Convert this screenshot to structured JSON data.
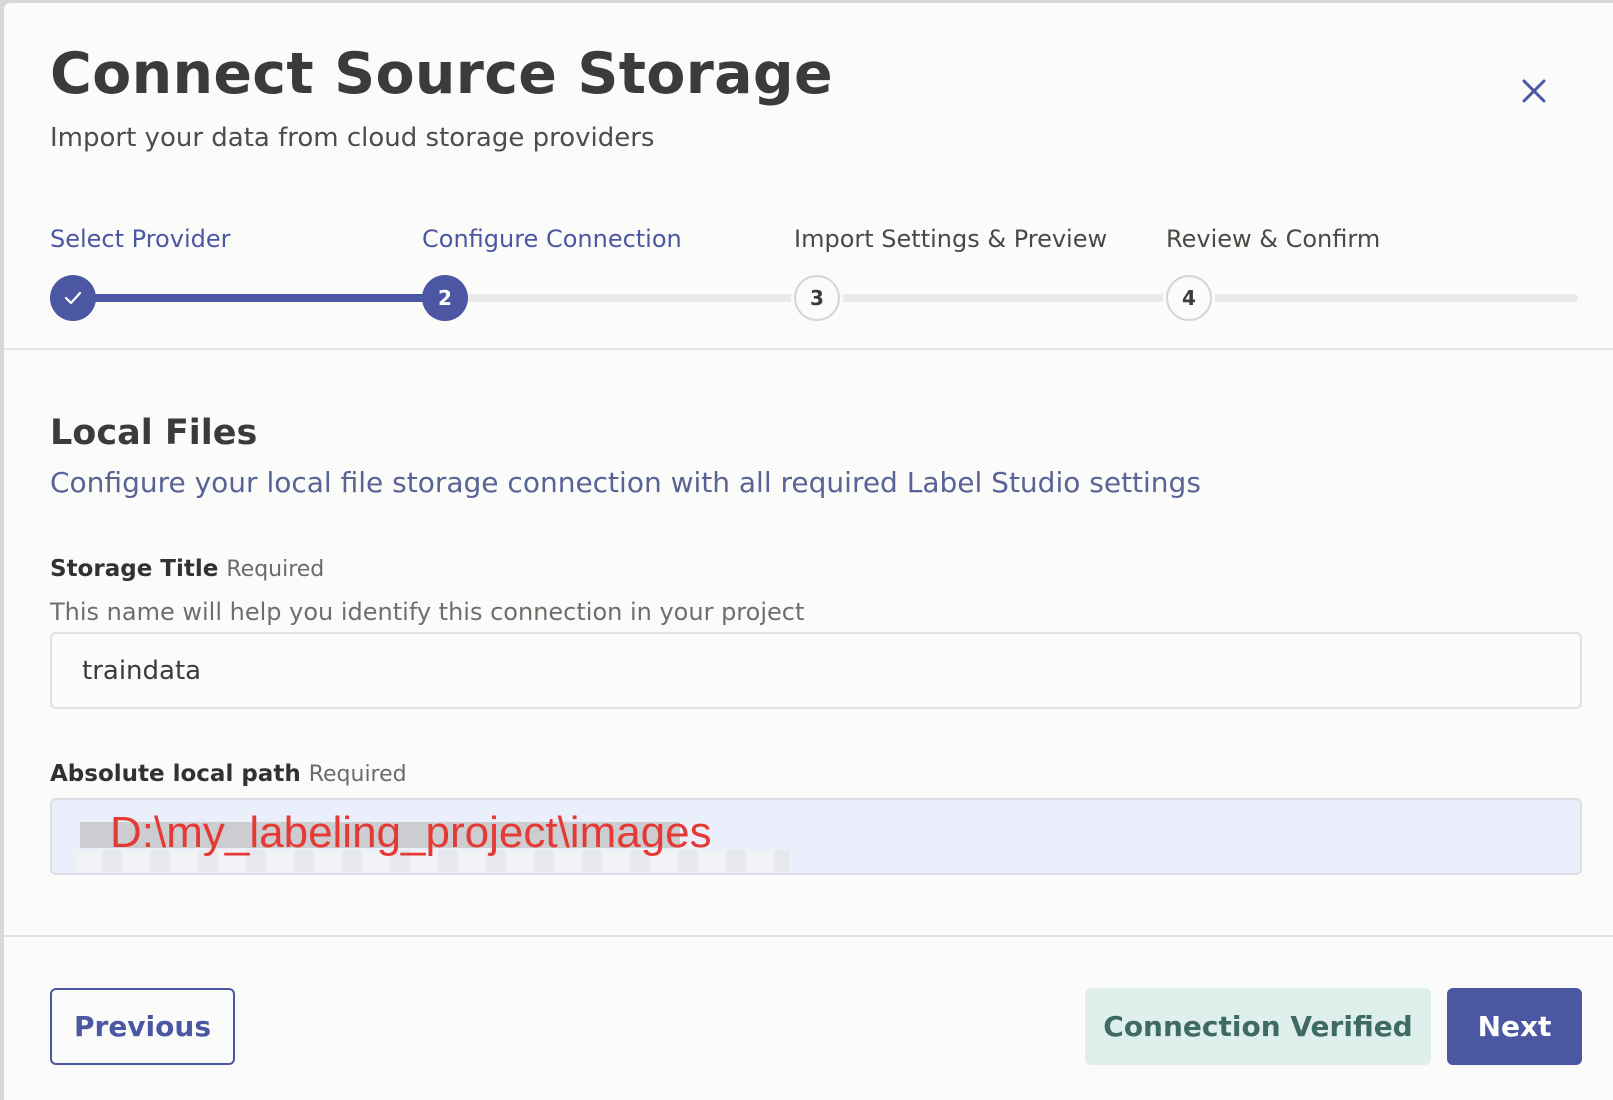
{
  "dialog": {
    "title": "Connect Source Storage",
    "subtitle": "Import your data from cloud storage providers",
    "close_icon": "close-icon"
  },
  "stepper": {
    "steps": [
      {
        "label": "Select Provider",
        "number": "",
        "state": "completed"
      },
      {
        "label": "Configure Connection",
        "number": "2",
        "state": "current"
      },
      {
        "label": "Import Settings & Preview",
        "number": "3",
        "state": "upcoming"
      },
      {
        "label": "Review & Confirm",
        "number": "4",
        "state": "upcoming"
      }
    ]
  },
  "section": {
    "title": "Local Files",
    "description": "Configure your local file storage connection with all required Label Studio settings"
  },
  "fields": {
    "storage_title": {
      "label": "Storage Title",
      "required": "Required",
      "help": "This name will help you identify this connection in your project",
      "value": "traindata"
    },
    "local_path": {
      "label": "Absolute local path",
      "required": "Required",
      "value": "D:\\my_labeling_project\\images"
    }
  },
  "footer": {
    "previous": "Previous",
    "verified": "Connection Verified",
    "next": "Next"
  },
  "colors": {
    "accent": "#4b57a2",
    "verified_bg": "#dff0ec",
    "verified_text": "#3e6c62",
    "annotation_red": "#e53935"
  }
}
